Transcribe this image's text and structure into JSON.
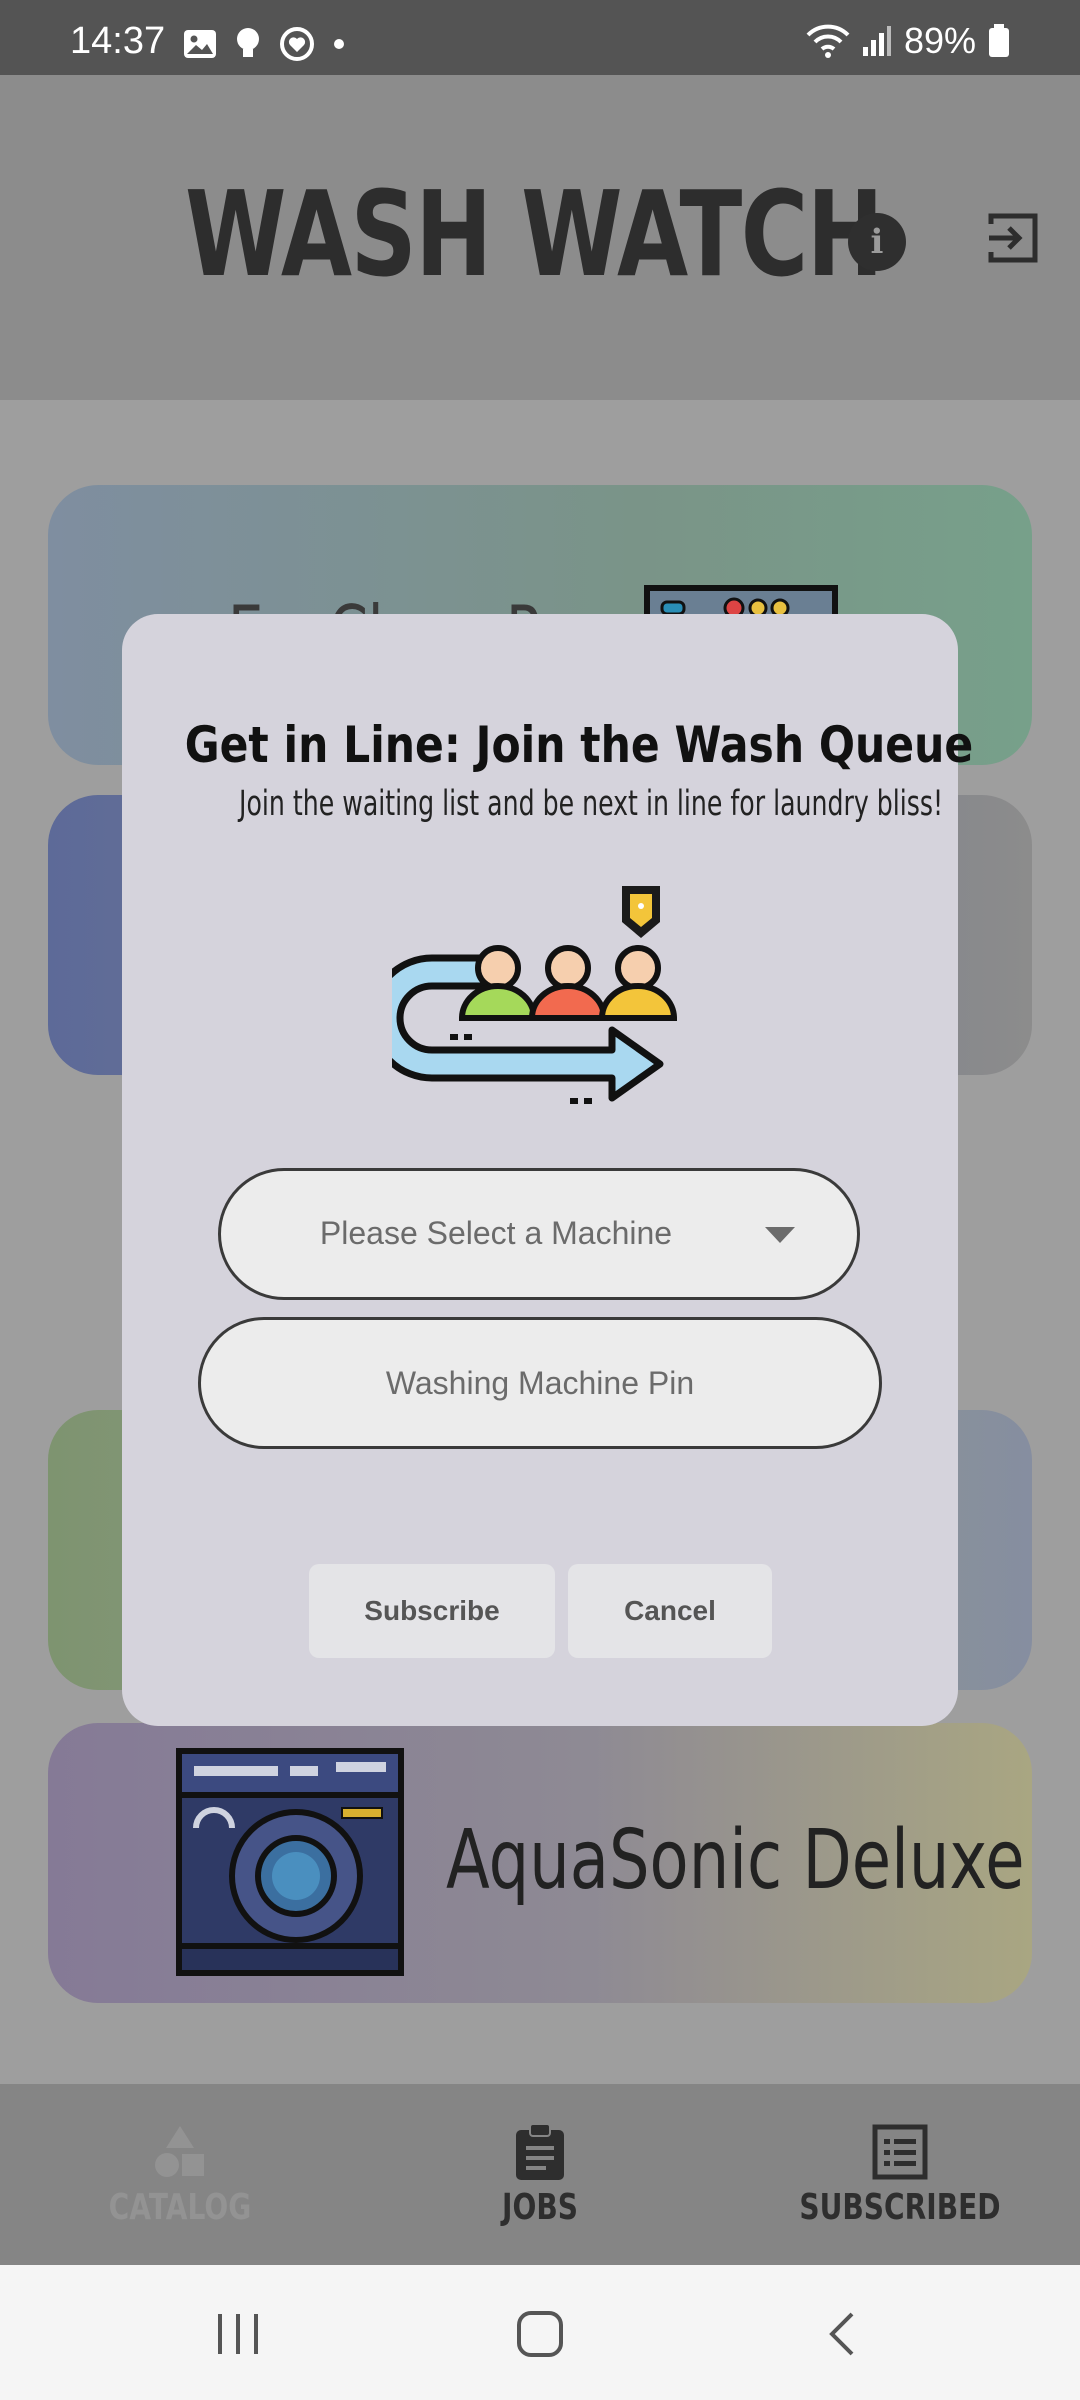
{
  "status_bar": {
    "time": "14:37",
    "battery": "89%"
  },
  "app": {
    "title": "WASH WATCH"
  },
  "machines": [
    {
      "name": "EcoClean Pro"
    },
    {
      "name": "AquaSonic Deluxe"
    }
  ],
  "dialog": {
    "title": "Get in Line: Join the Wash Queue",
    "subtitle": "Join the waiting list and be next in line for laundry bliss!",
    "select_placeholder": "Please Select a Machine",
    "pin_placeholder": "Washing Machine Pin",
    "subscribe_label": "Subscribe",
    "cancel_label": "Cancel"
  },
  "bottom_nav": {
    "items": [
      {
        "label": "CATALOG",
        "icon": "catalog-icon",
        "active": false
      },
      {
        "label": "JOBS",
        "icon": "clipboard-icon",
        "active": true
      },
      {
        "label": "SUBSCRIBED",
        "icon": "list-icon",
        "active": true
      }
    ]
  },
  "colors": {
    "dialog_bg": "#d5d3dc",
    "scrim": "#9e9e9e"
  }
}
